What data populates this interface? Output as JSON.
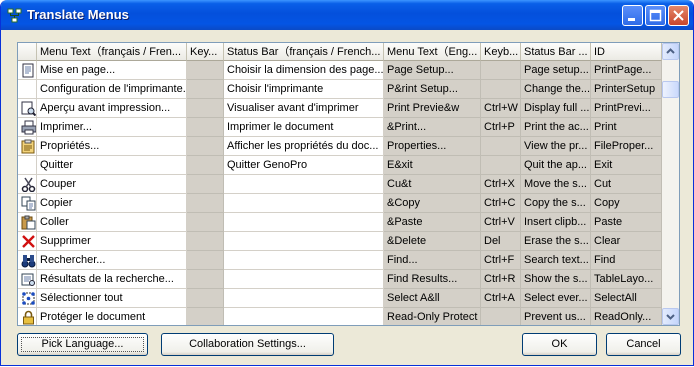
{
  "window": {
    "title": "Translate Menus"
  },
  "columns": [
    "Menu Text（français / Fren...",
    "Key...",
    "Status Bar（français / French...",
    "Menu Text（Eng...",
    "Keyb...",
    "Status Bar ...",
    "ID"
  ],
  "rows": [
    {
      "icon": "page-setup-icon",
      "menu_fr": "Mise en page...",
      "key_fr": "",
      "status_fr": "Choisir la dimension des page...",
      "menu_en": "Page Setup...",
      "key_en": "",
      "status_en": "Page setup...",
      "id": "PrintPage..."
    },
    {
      "icon": "",
      "menu_fr": "Configuration de l'imprimante...",
      "key_fr": "",
      "status_fr": "Choisir l'imprimante",
      "menu_en": "P&rint Setup...",
      "key_en": "",
      "status_en": "Change the...",
      "id": "PrinterSetup"
    },
    {
      "icon": "print-preview-icon",
      "menu_fr": "Aperçu avant impression...",
      "key_fr": "",
      "status_fr": "Visualiser avant d'imprimer",
      "menu_en": "Print Previe&w",
      "key_en": "Ctrl+W",
      "status_en": "Display full ...",
      "id": "PrintPrevi..."
    },
    {
      "icon": "printer-icon",
      "menu_fr": "Imprimer...",
      "key_fr": "",
      "status_fr": "Imprimer le document",
      "menu_en": "&Print...",
      "key_en": "Ctrl+P",
      "status_en": "Print the ac...",
      "id": "Print"
    },
    {
      "icon": "properties-icon",
      "menu_fr": "Propriétés...",
      "key_fr": "",
      "status_fr": "Afficher les propriétés du doc...",
      "menu_en": "Properties...",
      "key_en": "",
      "status_en": "View the pr...",
      "id": "FileProper..."
    },
    {
      "icon": "",
      "menu_fr": "Quitter",
      "key_fr": "",
      "status_fr": "Quitter GenoPro",
      "menu_en": "E&xit",
      "key_en": "",
      "status_en": "Quit the ap...",
      "id": "Exit"
    },
    {
      "icon": "scissors-icon",
      "menu_fr": "Couper",
      "key_fr": "",
      "status_fr": "",
      "menu_en": "Cu&t",
      "key_en": "Ctrl+X",
      "status_en": "Move the s...",
      "id": "Cut"
    },
    {
      "icon": "copy-icon",
      "menu_fr": "Copier",
      "key_fr": "",
      "status_fr": "",
      "menu_en": "&Copy",
      "key_en": "Ctrl+C",
      "status_en": "Copy the s...",
      "id": "Copy"
    },
    {
      "icon": "paste-icon",
      "menu_fr": "Coller",
      "key_fr": "",
      "status_fr": "",
      "menu_en": "&Paste",
      "key_en": "Ctrl+V",
      "status_en": "Insert clipb...",
      "id": "Paste"
    },
    {
      "icon": "delete-x-icon",
      "menu_fr": "Supprimer",
      "key_fr": "",
      "status_fr": "",
      "menu_en": "&Delete",
      "key_en": "Del",
      "status_en": "Erase the s...",
      "id": "Clear"
    },
    {
      "icon": "binoculars-icon",
      "menu_fr": "Rechercher...",
      "key_fr": "",
      "status_fr": "",
      "menu_en": "Find...",
      "key_en": "Ctrl+F",
      "status_en": "Search text...",
      "id": "Find"
    },
    {
      "icon": "find-results-icon",
      "menu_fr": "Résultats de la recherche...",
      "key_fr": "",
      "status_fr": "",
      "menu_en": "Find Results...",
      "key_en": "Ctrl+R",
      "status_en": "Show the s...",
      "id": "TableLayo..."
    },
    {
      "icon": "select-all-icon",
      "menu_fr": "Sélectionner tout",
      "key_fr": "",
      "status_fr": "",
      "menu_en": "Select A&ll",
      "key_en": "Ctrl+A",
      "status_en": "Select ever...",
      "id": "SelectAll"
    },
    {
      "icon": "lock-icon",
      "menu_fr": "Protéger le document",
      "key_fr": "",
      "status_fr": "",
      "menu_en": "Read-Only Protect",
      "key_en": "",
      "status_en": "Prevent us...",
      "id": "ReadOnly..."
    }
  ],
  "buttons": {
    "pick_language": "Pick Language...",
    "collaboration_settings": "Collaboration Settings...",
    "ok": "OK",
    "cancel": "Cancel"
  },
  "colors": {
    "titlebar": "#0450dc",
    "english_columns": "#d4d0c8",
    "dialog_bg": "#ece9d8"
  }
}
